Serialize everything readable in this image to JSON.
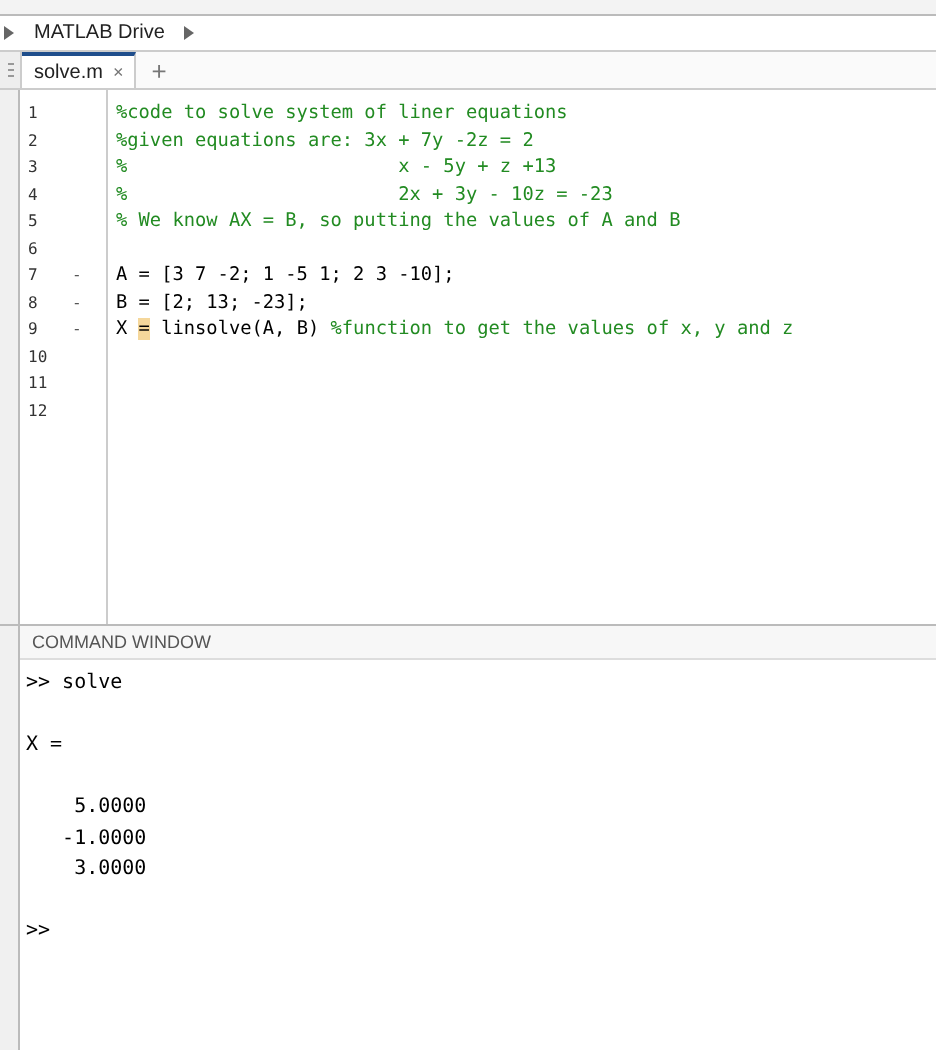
{
  "address_bar": {
    "path": [
      "MATLAB Drive"
    ]
  },
  "editor_tabs": [
    {
      "label": "solve.m",
      "close": "×",
      "selected": true
    }
  ],
  "new_tab": "+",
  "editor": {
    "lines": [
      {
        "number": "1",
        "segments": [
          {
            "kind": "comment",
            "text": "%code to solve system of liner equations"
          }
        ]
      },
      {
        "number": "2",
        "segments": [
          {
            "kind": "comment",
            "text": "%given equations are: 3x + 7y -2z = 2"
          }
        ]
      },
      {
        "number": "3",
        "segments": [
          {
            "kind": "comment",
            "text": "%                        x - 5y + z +13"
          }
        ]
      },
      {
        "number": "4",
        "segments": [
          {
            "kind": "comment",
            "text": "%                        2x + 3y - 10z = -23"
          }
        ]
      },
      {
        "number": "5",
        "segments": [
          {
            "kind": "comment",
            "text": "% We know AX = B, so putting the values of A and B"
          }
        ]
      },
      {
        "number": "6"
      },
      {
        "number": "7",
        "mark": "-",
        "segments": [
          {
            "kind": "code",
            "text": "A = [3 7 -2; 1 -5 1; 2 3 -10];"
          }
        ]
      },
      {
        "number": "8",
        "mark": "-",
        "segments": [
          {
            "kind": "code",
            "text": "B = [2; 13; -23];"
          }
        ]
      },
      {
        "number": "9",
        "mark": "-",
        "segments": [
          {
            "kind": "code",
            "text": "X "
          },
          {
            "kind": "highlight",
            "text": "="
          },
          {
            "kind": "code",
            "text": " linsolve(A, B) "
          },
          {
            "kind": "comment",
            "text": "%function to get the values of x, y and z"
          }
        ]
      },
      {
        "number": "10"
      },
      {
        "number": "11"
      },
      {
        "number": "12"
      }
    ]
  },
  "command_window": {
    "title": "COMMAND WINDOW",
    "lines": [
      {
        "kind": "input",
        "text": ">> solve"
      },
      {
        "kind": "blank"
      },
      {
        "kind": "output",
        "text": "X ="
      },
      {
        "kind": "blank"
      },
      {
        "kind": "number",
        "text": "    5.0000"
      },
      {
        "kind": "number",
        "text": "   -1.0000"
      },
      {
        "kind": "number",
        "text": "    3.0000"
      },
      {
        "kind": "blank"
      },
      {
        "kind": "prompt",
        "text": ">>"
      }
    ]
  }
}
